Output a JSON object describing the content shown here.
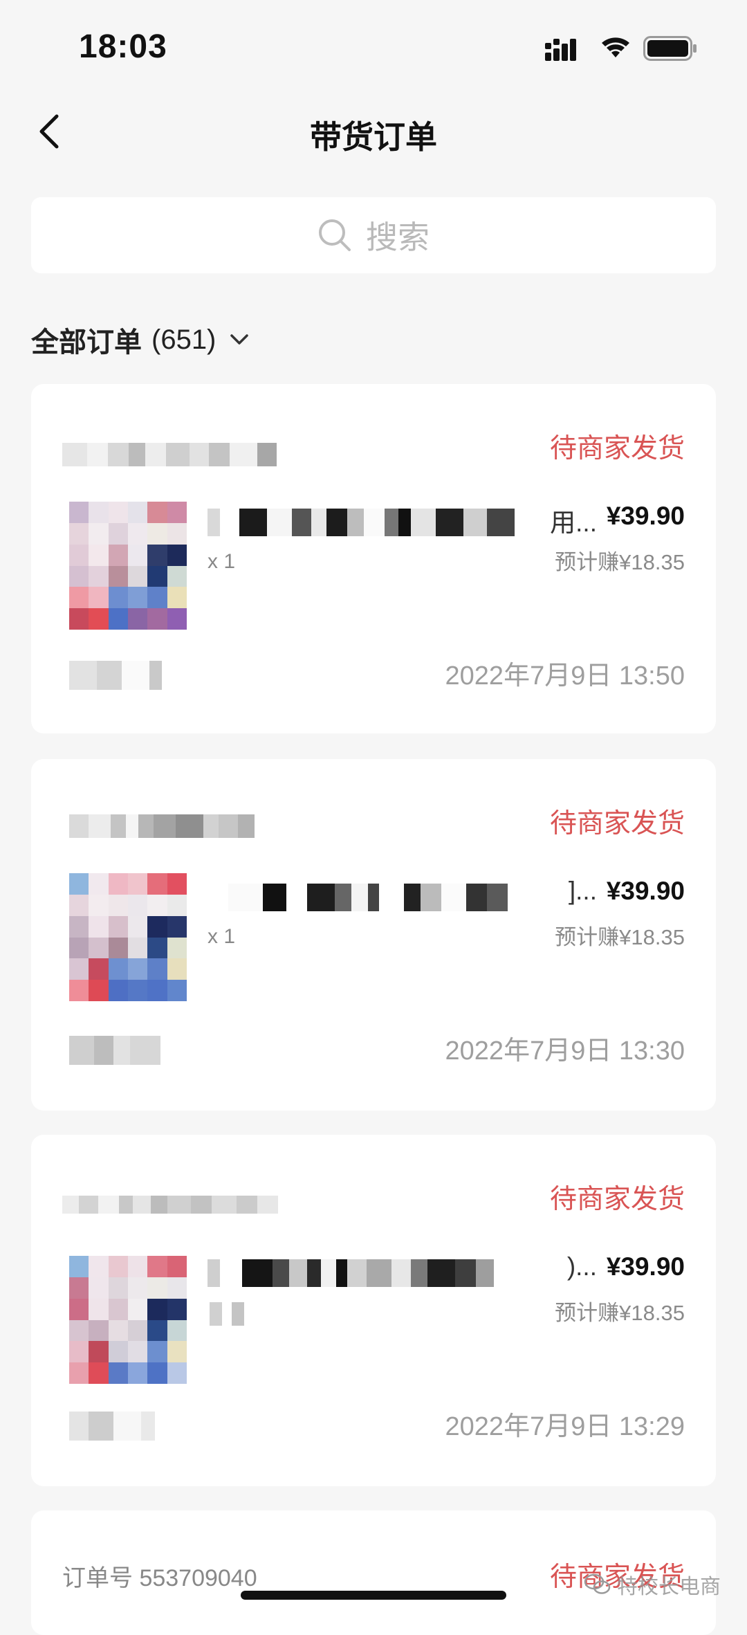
{
  "status_bar": {
    "time": "18:03"
  },
  "nav": {
    "title": "带货订单"
  },
  "search": {
    "placeholder": "搜索"
  },
  "filter": {
    "label": "全部订单",
    "count": "(651)"
  },
  "orders": [
    {
      "status": "待商家发货",
      "title_tail": "用...",
      "price": "¥39.90",
      "qty": "x 1",
      "earning": "预计赚¥18.35",
      "time": "2022年7月9日 13:50"
    },
    {
      "status": "待商家发货",
      "title_tail": "]...",
      "price": "¥39.90",
      "qty": "x 1",
      "earning": "预计赚¥18.35",
      "time": "2022年7月9日 13:30"
    },
    {
      "status": "待商家发货",
      "title_tail": ")...",
      "price": "¥39.90",
      "qty": "",
      "earning": "预计赚¥18.35",
      "time": "2022年7月9日 13:29"
    },
    {
      "order_number": "订单号 553709040",
      "status": "待商家发货"
    }
  ],
  "watermark": {
    "text": "特校长电商"
  },
  "colors": {
    "status_red": "#d95454",
    "background": "#f6f6f6",
    "card": "#ffffff"
  }
}
